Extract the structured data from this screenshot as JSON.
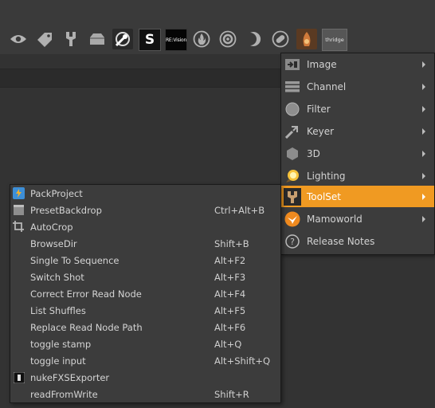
{
  "toolbar": {
    "icons": [
      "eye-icon",
      "tag-icon",
      "wrench-icon",
      "box-icon",
      "globe-wrench-icon",
      "s-logo-icon",
      "revision-icon",
      "fire-icon",
      "gear-icon",
      "moon-icon",
      "pill-icon",
      "eye-fire-icon",
      "thridge-icon"
    ],
    "revision_text": "RE:Vision",
    "s_text": "S",
    "thridge_text": "thridge"
  },
  "main_menu": {
    "items": [
      {
        "label": "Image",
        "icon": "image-icon",
        "has_submenu": true
      },
      {
        "label": "Channel",
        "icon": "channel-icon",
        "has_submenu": true
      },
      {
        "label": "Filter",
        "icon": "filter-icon",
        "has_submenu": true
      },
      {
        "label": "Keyer",
        "icon": "keyer-icon",
        "has_submenu": true
      },
      {
        "label": "3D",
        "icon": "3d-cube-icon",
        "has_submenu": true
      },
      {
        "label": "Lighting",
        "icon": "lighting-icon",
        "has_submenu": true
      },
      {
        "label": "ToolSet",
        "icon": "toolset-icon",
        "has_submenu": true,
        "active": true
      },
      {
        "label": "Mamoworld",
        "icon": "mamoworld-icon",
        "has_submenu": true
      },
      {
        "label": "Release Notes",
        "icon": "help-icon",
        "has_submenu": false
      }
    ],
    "active_color": "#f09a22"
  },
  "toolset_menu": {
    "items": [
      {
        "label": "PackProject",
        "shortcut": "",
        "icon": "packproject-icon"
      },
      {
        "label": "PresetBackdrop",
        "shortcut": "Ctrl+Alt+B",
        "icon": "backdrop-icon"
      },
      {
        "label": "AutoCrop",
        "shortcut": "",
        "icon": "autocrop-icon"
      },
      {
        "label": "BrowseDir",
        "shortcut": "Shift+B",
        "icon": ""
      },
      {
        "label": "Single To Sequence",
        "shortcut": "Alt+F2",
        "icon": ""
      },
      {
        "label": "Switch Shot",
        "shortcut": "Alt+F3",
        "icon": ""
      },
      {
        "label": "Correct Error Read Node",
        "shortcut": "Alt+F4",
        "icon": ""
      },
      {
        "label": "List Shuffles",
        "shortcut": "Alt+F5",
        "icon": ""
      },
      {
        "label": "Replace Read Node Path",
        "shortcut": "Alt+F6",
        "icon": ""
      },
      {
        "label": "toggle stamp",
        "shortcut": "Alt+Q",
        "icon": ""
      },
      {
        "label": "toggle input",
        "shortcut": "Alt+Shift+Q",
        "icon": ""
      },
      {
        "label": "nukeFXSExporter",
        "shortcut": "",
        "icon": "exporter-icon"
      },
      {
        "label": "readFromWrite",
        "shortcut": "Shift+R",
        "icon": ""
      }
    ]
  }
}
